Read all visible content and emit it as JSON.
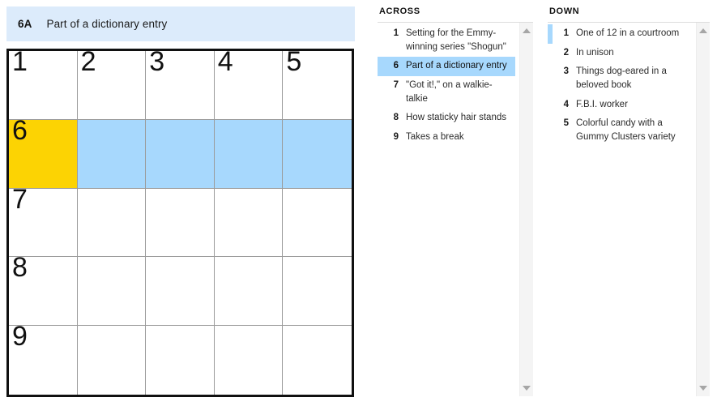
{
  "colors": {
    "active_cell": "#fcd303",
    "word_highlight": "#a7d8fd",
    "clue_bar_bg": "#dcebfb",
    "grid_border": "#101010",
    "grid_line": "#9b9b9b"
  },
  "clue_bar": {
    "number": "6A",
    "text": "Part of a dictionary entry"
  },
  "grid": {
    "rows": 5,
    "cols": 5,
    "cells": [
      {
        "number": "1",
        "letter": "",
        "state": "normal"
      },
      {
        "number": "2",
        "letter": "",
        "state": "normal"
      },
      {
        "number": "3",
        "letter": "",
        "state": "normal"
      },
      {
        "number": "4",
        "letter": "",
        "state": "normal"
      },
      {
        "number": "5",
        "letter": "",
        "state": "normal"
      },
      {
        "number": "6",
        "letter": "",
        "state": "active"
      },
      {
        "number": "",
        "letter": "",
        "state": "highlight"
      },
      {
        "number": "",
        "letter": "",
        "state": "highlight"
      },
      {
        "number": "",
        "letter": "",
        "state": "highlight"
      },
      {
        "number": "",
        "letter": "",
        "state": "highlight"
      },
      {
        "number": "7",
        "letter": "",
        "state": "normal"
      },
      {
        "number": "",
        "letter": "",
        "state": "normal"
      },
      {
        "number": "",
        "letter": "",
        "state": "normal"
      },
      {
        "number": "",
        "letter": "",
        "state": "normal"
      },
      {
        "number": "",
        "letter": "",
        "state": "normal"
      },
      {
        "number": "8",
        "letter": "",
        "state": "normal"
      },
      {
        "number": "",
        "letter": "",
        "state": "normal"
      },
      {
        "number": "",
        "letter": "",
        "state": "normal"
      },
      {
        "number": "",
        "letter": "",
        "state": "normal"
      },
      {
        "number": "",
        "letter": "",
        "state": "normal"
      },
      {
        "number": "9",
        "letter": "",
        "state": "normal"
      },
      {
        "number": "",
        "letter": "",
        "state": "normal"
      },
      {
        "number": "",
        "letter": "",
        "state": "normal"
      },
      {
        "number": "",
        "letter": "",
        "state": "normal"
      },
      {
        "number": "",
        "letter": "",
        "state": "normal"
      }
    ]
  },
  "across": {
    "heading": "ACROSS",
    "clues": [
      {
        "number": "1",
        "text": "Setting for the Emmy-winning series \"Shogun\"",
        "state": "normal"
      },
      {
        "number": "6",
        "text": "Part of a dictionary entry",
        "state": "selected"
      },
      {
        "number": "7",
        "text": "\"Got it!,\" on a walkie-talkie",
        "state": "normal"
      },
      {
        "number": "8",
        "text": "How staticky hair stands",
        "state": "normal"
      },
      {
        "number": "9",
        "text": "Takes a break",
        "state": "normal"
      }
    ]
  },
  "down": {
    "heading": "DOWN",
    "clues": [
      {
        "number": "1",
        "text": "One of 12 in a courtroom",
        "state": "cross"
      },
      {
        "number": "2",
        "text": "In unison",
        "state": "normal"
      },
      {
        "number": "3",
        "text": "Things dog-eared in a beloved book",
        "state": "normal"
      },
      {
        "number": "4",
        "text": "F.B.I. worker",
        "state": "normal"
      },
      {
        "number": "5",
        "text": "Colorful candy with a Gummy Clusters variety",
        "state": "normal"
      }
    ]
  },
  "scrollbars": {
    "across": {
      "up_icon": "triangle-up-icon",
      "down_icon": "triangle-down-icon"
    },
    "down": {
      "up_icon": "triangle-up-icon",
      "down_icon": "triangle-down-icon"
    }
  }
}
